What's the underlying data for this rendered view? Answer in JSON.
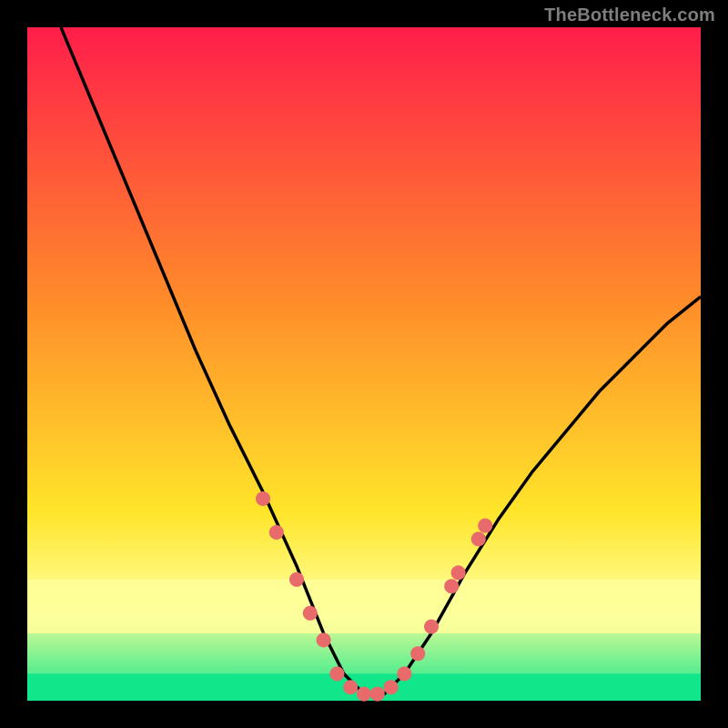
{
  "attribution": "TheBottleneck.com",
  "colors": {
    "background": "#000000",
    "gradient_top": "#ff1e4a",
    "gradient_mid1": "#ff8a2a",
    "gradient_mid2": "#ffe52a",
    "gradient_band": "#ffff9a",
    "gradient_bottom": "#12e68a",
    "curve": "#000000",
    "dots": "#e86a6a"
  },
  "chart_data": {
    "type": "line",
    "title": "",
    "xlabel": "",
    "ylabel": "",
    "xlim": [
      0,
      100
    ],
    "ylim": [
      0,
      100
    ],
    "grid": false,
    "series": [
      {
        "name": "bottleneck-curve",
        "x": [
          5,
          10,
          15,
          20,
          25,
          30,
          35,
          40,
          44,
          47,
          50,
          53,
          56,
          60,
          65,
          70,
          75,
          80,
          85,
          90,
          95,
          100
        ],
        "y": [
          100,
          88,
          76,
          64,
          52,
          41,
          31,
          20,
          10,
          4,
          1,
          1,
          4,
          10,
          19,
          27,
          34,
          40,
          46,
          51,
          56,
          60
        ]
      }
    ],
    "markers": {
      "name": "sample-points",
      "points": [
        {
          "x": 35,
          "y": 30
        },
        {
          "x": 37,
          "y": 25
        },
        {
          "x": 40,
          "y": 18
        },
        {
          "x": 42,
          "y": 13
        },
        {
          "x": 44,
          "y": 9
        },
        {
          "x": 46,
          "y": 4
        },
        {
          "x": 48,
          "y": 2
        },
        {
          "x": 50,
          "y": 1
        },
        {
          "x": 52,
          "y": 1
        },
        {
          "x": 54,
          "y": 2
        },
        {
          "x": 56,
          "y": 4
        },
        {
          "x": 58,
          "y": 7
        },
        {
          "x": 60,
          "y": 11
        },
        {
          "x": 63,
          "y": 17
        },
        {
          "x": 64,
          "y": 19
        },
        {
          "x": 67,
          "y": 24
        },
        {
          "x": 68,
          "y": 26
        }
      ]
    }
  }
}
